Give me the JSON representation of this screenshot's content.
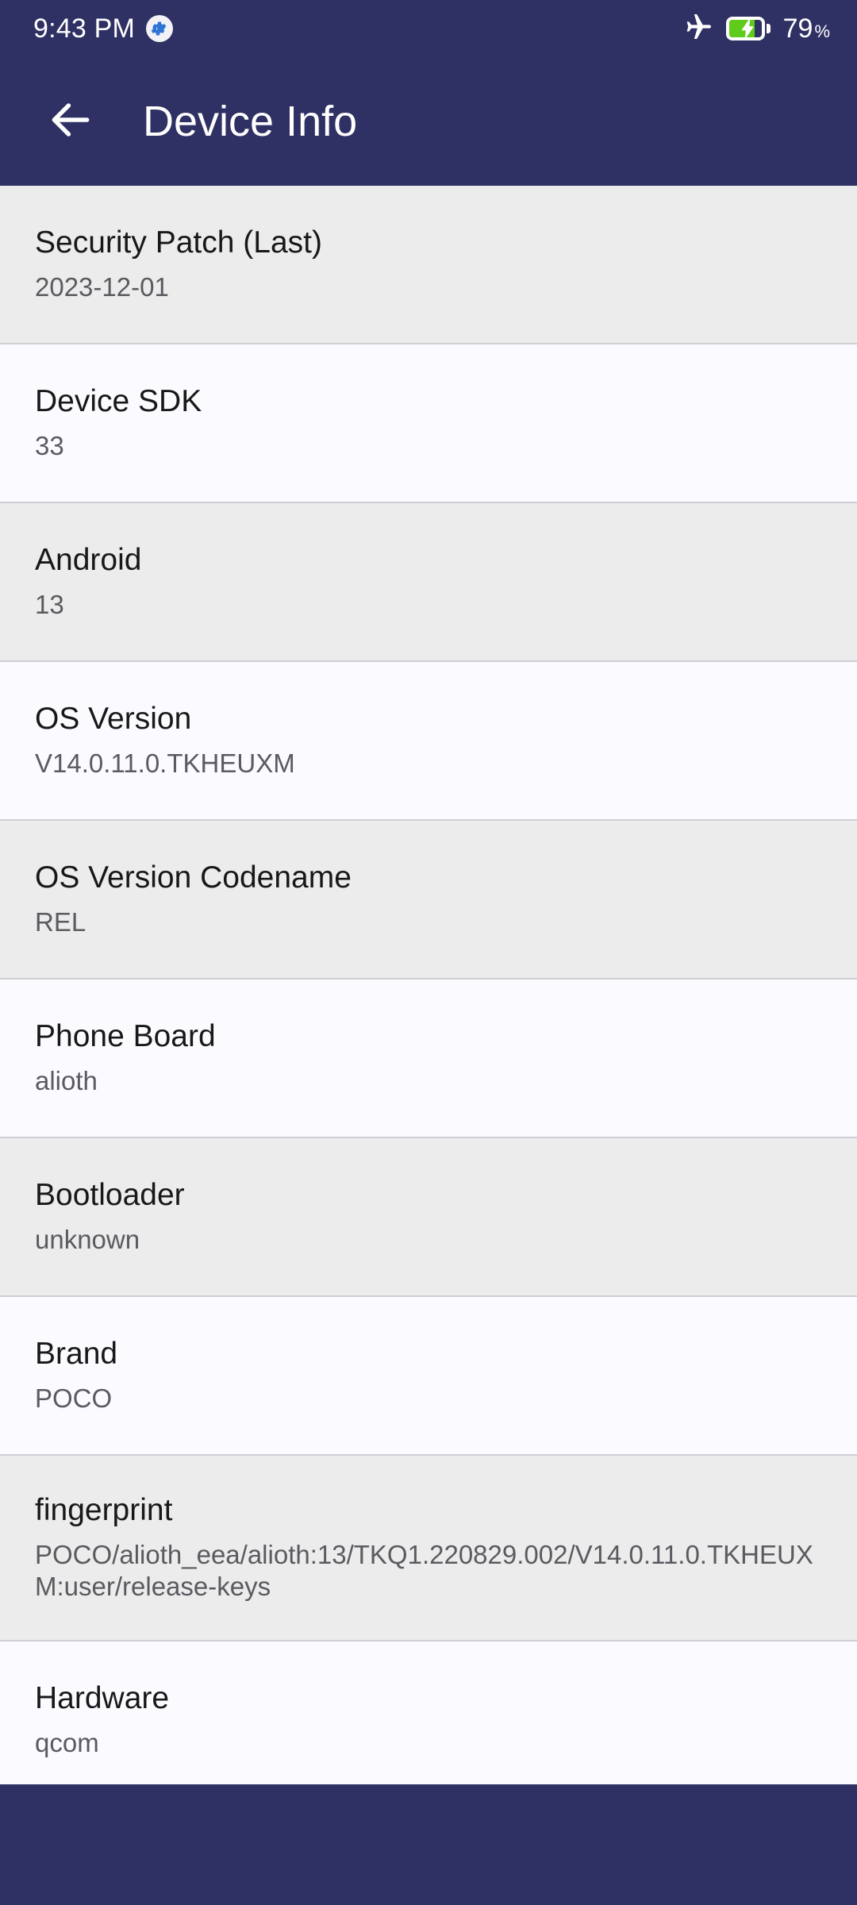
{
  "status_bar": {
    "clock": "9:43 PM",
    "notification_icon": "settings-gear-icon",
    "airplane_icon": "airplane-mode-icon",
    "battery_icon": "battery-charging-icon",
    "battery_percent": "79",
    "battery_percent_symbol": "%",
    "battery_level": 79
  },
  "app_bar": {
    "back_icon": "arrow-back-icon",
    "title": "Device Info"
  },
  "colors": {
    "header_navy": "#2f3063",
    "row_shaded": "#ececec",
    "row_plain": "#fbfaff",
    "divider": "#cfcfd6",
    "label_text": "#18181a",
    "value_text": "#5a5a60",
    "battery_green": "#5fcc1c",
    "gear_blue": "#2e74d4"
  },
  "info_rows": [
    {
      "label": "Security Patch (Last)",
      "value": "2023-12-01"
    },
    {
      "label": "Device SDK",
      "value": "33"
    },
    {
      "label": "Android",
      "value": "13"
    },
    {
      "label": "OS Version",
      "value": "V14.0.11.0.TKHEUXM"
    },
    {
      "label": "OS Version Codename",
      "value": "REL"
    },
    {
      "label": "Phone Board",
      "value": "alioth"
    },
    {
      "label": "Bootloader",
      "value": "unknown"
    },
    {
      "label": "Brand",
      "value": "POCO"
    },
    {
      "label": "fingerprint",
      "value": "POCO/alioth_eea/alioth:13/TKQ1.220829.002/V14.0.11.0.TKHEUXM:user/release-keys"
    },
    {
      "label": "Hardware",
      "value": "qcom"
    }
  ]
}
